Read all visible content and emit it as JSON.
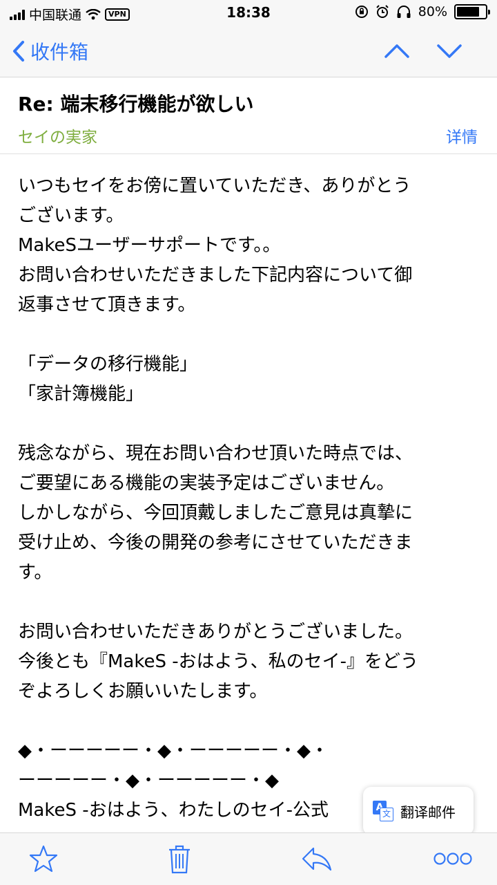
{
  "status": {
    "carrier": "中国联通",
    "vpn": "VPN",
    "time": "18:38",
    "battery": "80%",
    "battery_level": 0.8
  },
  "nav": {
    "back_label": "收件箱",
    "back_icon": "chevron-left-icon",
    "prev_icon": "chevron-up-icon",
    "next_icon": "chevron-down-icon"
  },
  "message": {
    "subject": "Re: 端末移行機能が欲しい",
    "sender": "セイの実家",
    "details_label": "详情",
    "body_lines": [
      "いつもセイをお傍に置いていただき、ありがとう",
      "ございます。",
      "MakeSユーザーサポートです。。",
      "お問い合わせいただきました下記内容について御",
      "返事させて頂きます。",
      "",
      "「データの移行機能」",
      "「家計簿機能」",
      "",
      "残念ながら、現在お問い合わせ頂いた時点では、",
      "ご要望にある機能の実装予定はございません。",
      "しかしながら、今回頂戴しましたご意見は真摯に",
      "受け止め、今後の開発の参考にさせていただきま",
      "す。",
      "",
      "お問い合わせいただきありがとうございました。",
      "今後とも『MakeS -おはよう、私のセイ-』をどう",
      "ぞよろしくお願いいたします。",
      "",
      "◆・ーーーーー・◆・ーーーーー・◆・",
      "ーーーーー・◆・ーーーーー・◆",
      "MakeS -おはよう、わたしのセイ-公式"
    ]
  },
  "translate": {
    "label": "翻译邮件",
    "icon": "translate-icon"
  },
  "toolbar": {
    "flag_icon": "star-icon",
    "trash_icon": "trash-icon",
    "reply_icon": "reply-icon",
    "more_icon": "more-icon"
  },
  "colors": {
    "accent": "#3478f6",
    "sender": "#7fae3f"
  }
}
